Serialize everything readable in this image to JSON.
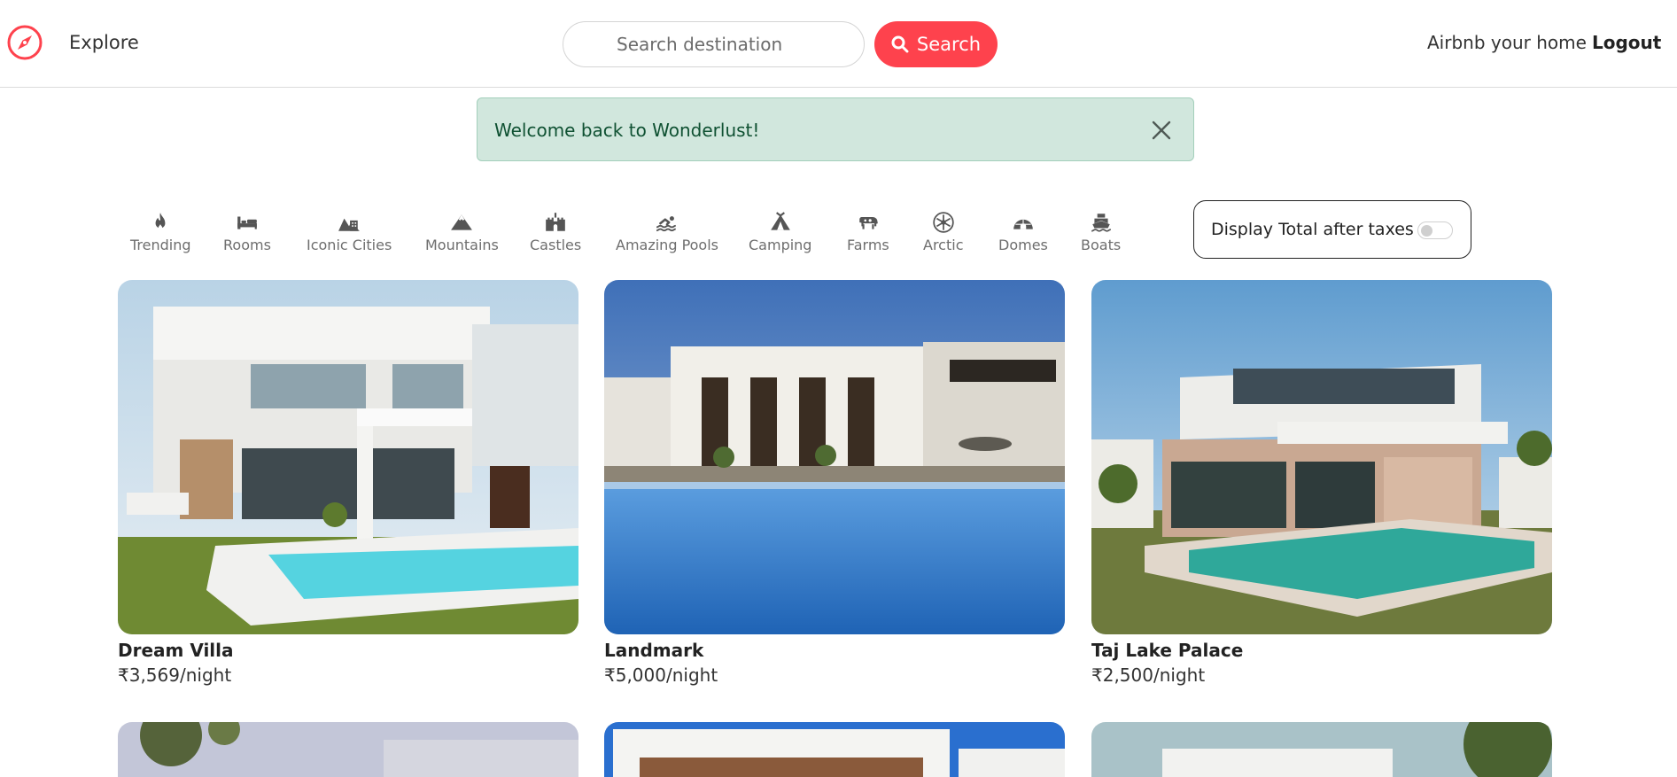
{
  "navbar": {
    "logo_icon": "compass-icon",
    "explore_label": "Explore",
    "search_placeholder": "Search destination",
    "search_button_label": "Search",
    "search_icon": "search-icon",
    "host_label": "Airbnb your home",
    "logout_label": "Logout",
    "brand_color": "#fe424d"
  },
  "alert": {
    "message": "Welcome back to Wonderlust!",
    "close_icon": "close-icon",
    "background_color": "#d1e7dd"
  },
  "filters": [
    {
      "label": "Trending",
      "icon": "fire-icon"
    },
    {
      "label": "Rooms",
      "icon": "bed-icon"
    },
    {
      "label": "Iconic Cities",
      "icon": "city-icon"
    },
    {
      "label": "Mountains",
      "icon": "mountain-icon"
    },
    {
      "label": "Castles",
      "icon": "castle-icon"
    },
    {
      "label": "Amazing Pools",
      "icon": "swimmer-icon"
    },
    {
      "label": "Camping",
      "icon": "tent-icon"
    },
    {
      "label": "Farms",
      "icon": "cow-icon"
    },
    {
      "label": "Arctic",
      "icon": "snowflake-icon"
    },
    {
      "label": "Domes",
      "icon": "igloo-icon"
    },
    {
      "label": "Boats",
      "icon": "ship-icon"
    }
  ],
  "tax_toggle": {
    "label": "Display Total after taxes",
    "enabled": false
  },
  "listings": [
    {
      "title": "Dream Villa",
      "price": "₹3,569/night"
    },
    {
      "title": "Landmark",
      "price": "₹5,000/night"
    },
    {
      "title": "Taj Lake Palace",
      "price": "₹2,500/night"
    }
  ]
}
